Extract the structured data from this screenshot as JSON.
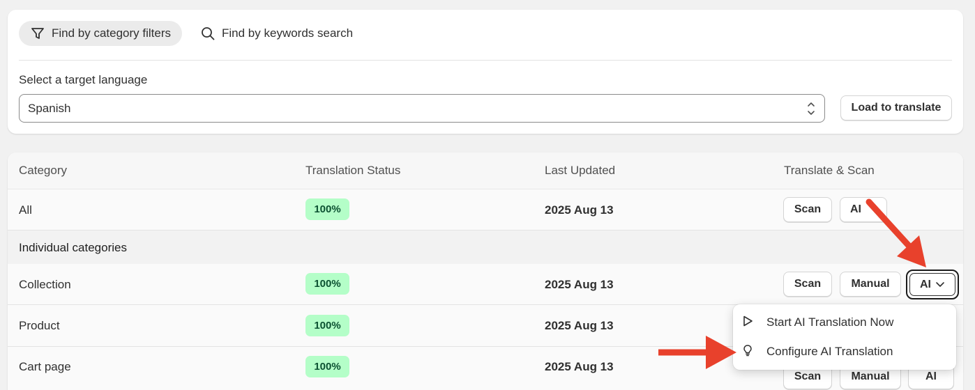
{
  "filters": {
    "tabs": [
      {
        "label": "Find by category filters",
        "icon": "filter-icon",
        "active": true
      },
      {
        "label": "Find by keywords search",
        "icon": "search-icon",
        "active": false
      }
    ],
    "language_label": "Select a target language",
    "language_value": "Spanish",
    "load_button": "Load to translate"
  },
  "table": {
    "headers": [
      "Category",
      "Translation Status",
      "Last Updated",
      "Translate & Scan"
    ],
    "section_label": "Individual categories",
    "rows": [
      {
        "category": "All",
        "status": "100%",
        "updated": "2025 Aug 13",
        "scan": "Scan",
        "ai": "AI"
      },
      {
        "category": "Collection",
        "status": "100%",
        "updated": "2025 Aug 13",
        "scan": "Scan",
        "manual": "Manual",
        "ai": "AI"
      },
      {
        "category": "Product",
        "status": "100%",
        "updated": "2025 Aug 13"
      },
      {
        "category": "Cart page",
        "status": "100%",
        "updated": "2025 Aug 13",
        "scan": "Scan",
        "manual": "Manual",
        "ai": "AI"
      }
    ]
  },
  "ai_menu": {
    "items": [
      {
        "label": "Start AI Translation Now",
        "icon": "play-icon"
      },
      {
        "label": "Configure AI Translation",
        "icon": "lightbulb-icon"
      }
    ]
  },
  "colors": {
    "badge_bg": "#b4fec8",
    "badge_text": "#0c5132",
    "annotation_arrow": "#e8412c"
  }
}
